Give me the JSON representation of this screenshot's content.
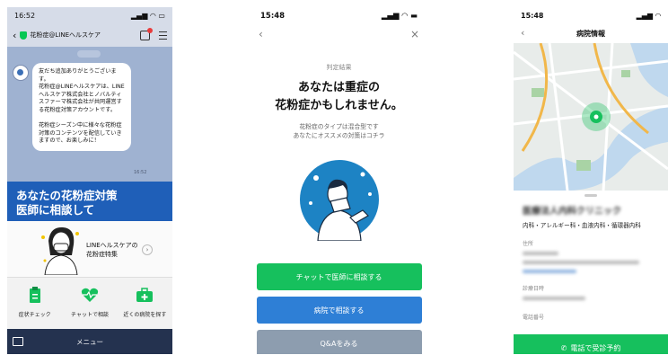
{
  "colors": {
    "line_green": "#16c05d",
    "line_blue": "#2e7fd6",
    "navy": "#24324f",
    "chat_bg": "#9fb2d1"
  },
  "phone1": {
    "status_time": "16:52",
    "status_icons": "signal-wifi-battery",
    "account_name": "花粉症@LINEヘルスケア",
    "message": "友だち追加ありがとうございます。\n花粉症@LINEヘルスケアは、LINEヘルスケア株式会社とノバルティスファーマ株式会社が共同運営する花粉症対策アカウントです。\n\n花粉症シーズン中に様々な花粉症対策のコンテンツを配信していきますので、お楽しみに！",
    "message_time": "16:52",
    "banner_text": "あなたの花粉症対策\n医師に相談して",
    "promo_text": "LINEヘルスケアの\n花粉症特集",
    "menu_items": [
      {
        "label": "症状チェック",
        "icon": "clipboard-icon"
      },
      {
        "label": "チャットで相談",
        "icon": "heart-pulse-icon"
      },
      {
        "label": "近くの病院を探す",
        "icon": "medical-kit-icon"
      }
    ],
    "bottom_menu_label": "メニュー"
  },
  "phone2": {
    "status_time": "15:48",
    "section_label": "判定結果",
    "result_title": "あなたは重症の\n花粉症かもしれません。",
    "result_sub": "花粉症のタイプは混合型です\nあなたにオススメの対策はコチラ",
    "buttons": [
      "チャットで医師に相談する",
      "病院で相談する",
      "Q&Aをみる"
    ]
  },
  "phone3": {
    "status_time": "15:48",
    "title": "病院情報",
    "hospital_name_blurred": "医療法人内科クリニック",
    "departments": "内科・アレルギー科・血液内科・循環器内科",
    "section_address": "住所",
    "section_hours": "診療日時",
    "section_phone": "電話番号",
    "call_button": "電話で受診予約"
  }
}
